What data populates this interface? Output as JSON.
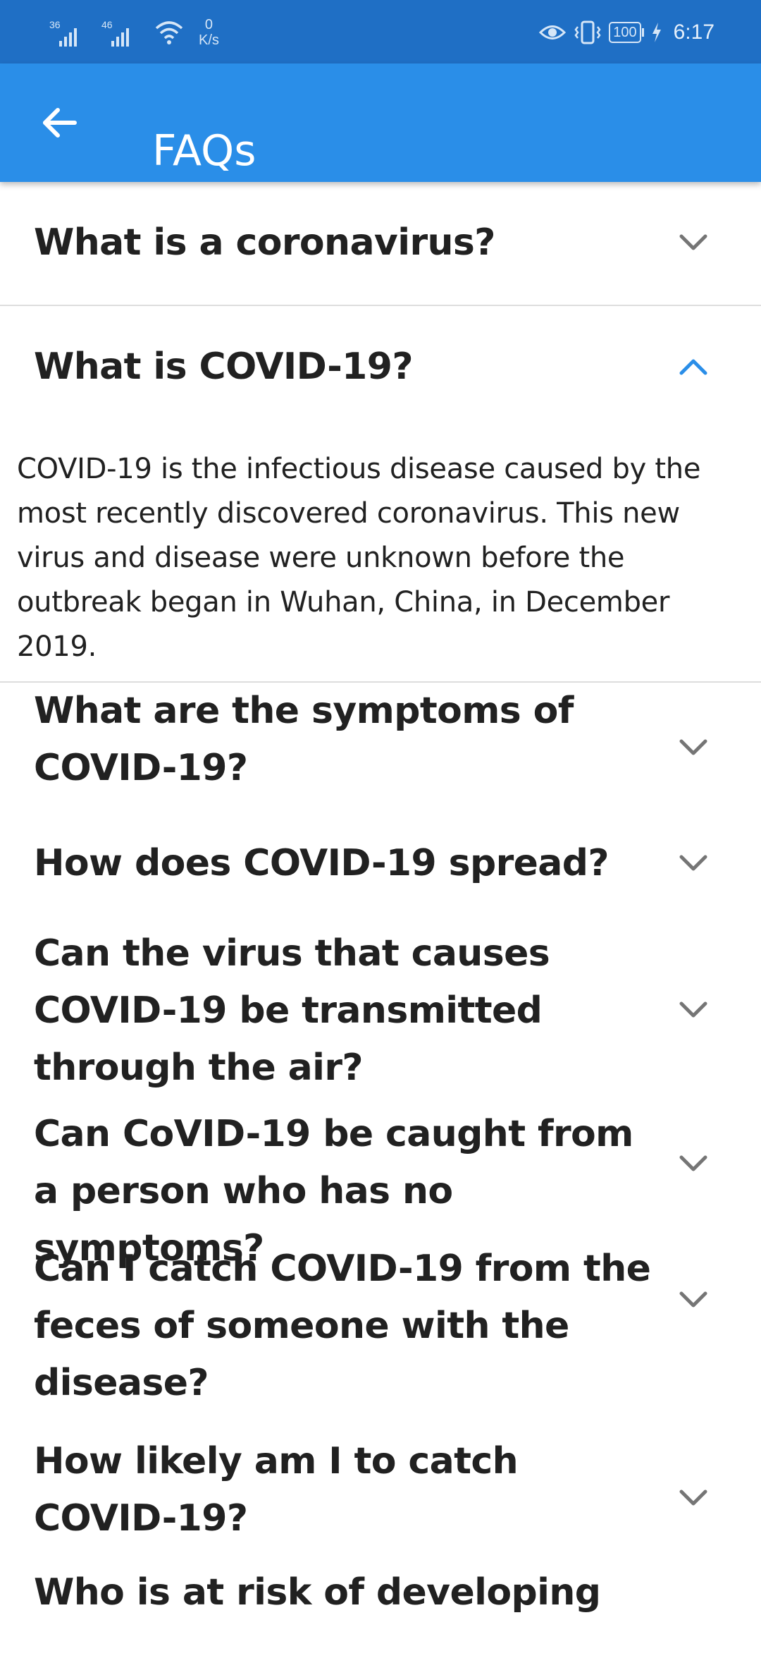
{
  "status_bar": {
    "network_1": "36",
    "network_2": "46",
    "speed_value": "0",
    "speed_unit": "K/s",
    "battery": "100",
    "time": "6:17"
  },
  "app_bar": {
    "title": "FAQs",
    "background": "#2a8ee8"
  },
  "faqs": [
    {
      "question": "What is a coronavirus?",
      "expanded": false
    },
    {
      "question": "What is COVID-19?",
      "expanded": true,
      "answer": "COVID-19 is the infectious disease caused by the most recently discovered coronavirus. This new virus and disease were unknown before the outbreak began in Wuhan, China, in December 2019."
    },
    {
      "question": "What are the symptoms of COVID-19?",
      "expanded": false
    },
    {
      "question": "How does COVID-19 spread?",
      "expanded": false
    },
    {
      "question": "Can the virus that causes COVID-19 be transmitted through the air?",
      "expanded": false
    },
    {
      "question": "Can CoVID-19 be caught from a person who has no symptoms?",
      "expanded": false
    },
    {
      "question": "Can I catch COVID-19 from the feces of someone with the disease?",
      "expanded": false
    },
    {
      "question": "How likely am I to catch COVID-19?",
      "expanded": false
    },
    {
      "question": "Who is at risk of developing",
      "expanded": false
    }
  ],
  "icons": {
    "back": "arrow-back-icon",
    "expand": "chevron-down-icon",
    "collapse": "chevron-up-icon"
  },
  "colors": {
    "accent": "#2a8ee8",
    "status_bar": "#1f6fc5",
    "chevron_collapsed": "#757575",
    "chevron_expanded": "#2a8ee8"
  }
}
